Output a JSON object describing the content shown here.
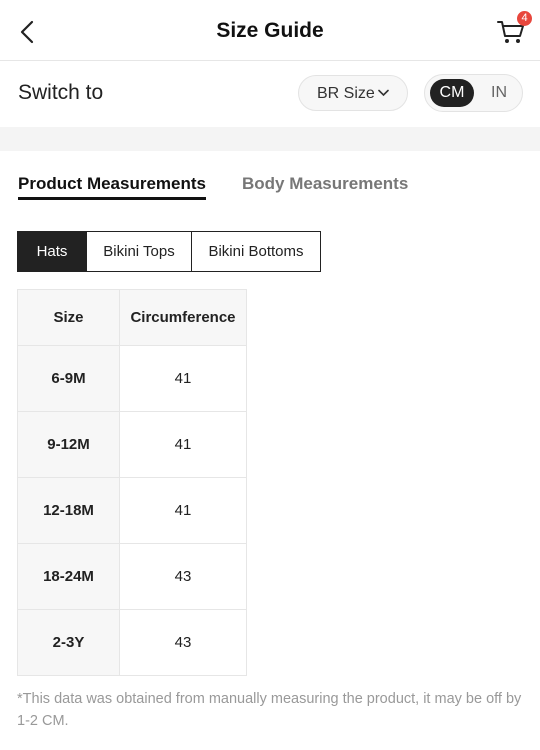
{
  "header": {
    "title": "Size Guide",
    "back_icon": "chevron-left-icon",
    "cart_icon": "cart-icon",
    "cart_badge": "4",
    "badge_color": "#e8473d"
  },
  "switch": {
    "label": "Switch to",
    "size_system": "BR Size",
    "dropdown_icon": "chevron-down-icon",
    "units": {
      "active": "CM",
      "inactive": "IN"
    }
  },
  "tabs": {
    "active": "Product Measurements",
    "inactive": "Body Measurements"
  },
  "categories": {
    "active": "Hats",
    "items": [
      "Hats",
      "Bikini Tops",
      "Bikini Bottoms"
    ]
  },
  "table": {
    "headers": [
      "Size",
      "Circumference"
    ],
    "rows": [
      [
        "6-9M",
        "41"
      ],
      [
        "9-12M",
        "41"
      ],
      [
        "12-18M",
        "41"
      ],
      [
        "18-24M",
        "43"
      ],
      [
        "2-3Y",
        "43"
      ]
    ]
  },
  "note": "*This data was obtained from manually measuring the product, it may be off by 1-2 CM."
}
